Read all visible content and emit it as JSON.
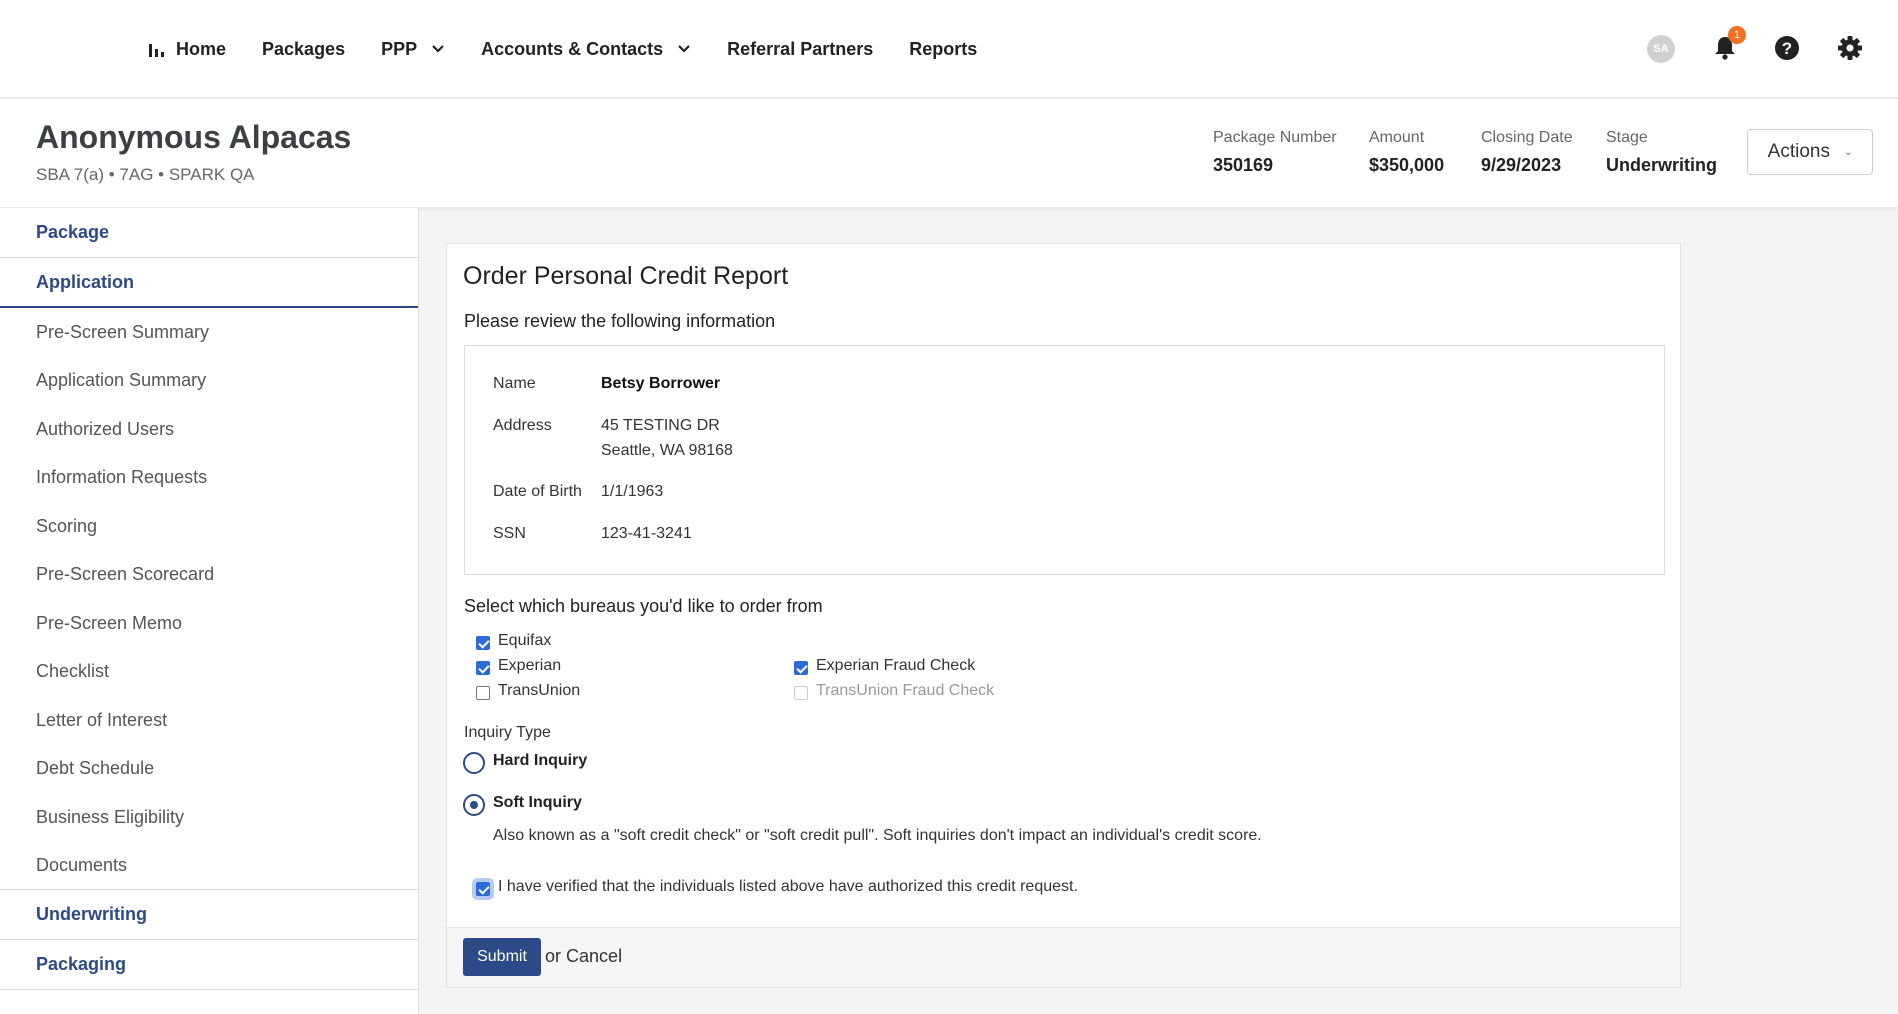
{
  "nav": {
    "items": [
      {
        "label": "Home"
      },
      {
        "label": "Packages"
      },
      {
        "label": "PPP"
      },
      {
        "label": "Accounts & Contacts"
      },
      {
        "label": "Referral Partners"
      },
      {
        "label": "Reports"
      }
    ],
    "avatar_initials": "SA",
    "notification_count": "1"
  },
  "header": {
    "title": "Anonymous Alpacas",
    "subtitle": "SBA 7(a) • 7AG • SPARK QA",
    "package_number_label": "Package Number",
    "package_number": "350169",
    "amount_label": "Amount",
    "amount": "$350,000",
    "closing_date_label": "Closing Date",
    "closing_date": "9/29/2023",
    "stage_label": "Stage",
    "stage": "Underwriting",
    "actions_label": "Actions"
  },
  "sidebar": {
    "package": "Package",
    "application": "Application",
    "items": [
      "Pre-Screen Summary",
      "Application Summary",
      "Authorized Users",
      "Information Requests",
      "Scoring",
      "Pre-Screen Scorecard",
      "Pre-Screen Memo",
      "Checklist",
      "Letter of Interest",
      "Debt Schedule",
      "Business Eligibility",
      "Documents"
    ],
    "underwriting": "Underwriting",
    "packaging": "Packaging"
  },
  "form": {
    "title": "Order Personal Credit Report",
    "review_text": "Please review the following information",
    "name_label": "Name",
    "name": "Betsy Borrower",
    "address_label": "Address",
    "address_line1": "45 TESTING DR",
    "address_line2": "Seattle, WA 98168",
    "dob_label": "Date of Birth",
    "dob": "1/1/1963",
    "ssn_label": "SSN",
    "ssn": "123-41-3241",
    "bureau_question": "Select which bureaus you'd like to order from",
    "bureaus": {
      "equifax": "Equifax",
      "experian": "Experian",
      "transunion": "TransUnion",
      "experian_fraud": "Experian Fraud Check",
      "transunion_fraud": "TransUnion Fraud Check"
    },
    "inquiry_type_label": "Inquiry Type",
    "hard_inquiry": "Hard Inquiry",
    "soft_inquiry": "Soft Inquiry",
    "soft_description": "Also known as a \"soft credit check\" or \"soft credit pull\". Soft inquiries don't impact an individual's credit score.",
    "verify_text": "I have verified that the individuals listed above have authorized this credit request.",
    "submit_label": "Submit",
    "or_text": "or",
    "cancel_label": "Cancel"
  }
}
